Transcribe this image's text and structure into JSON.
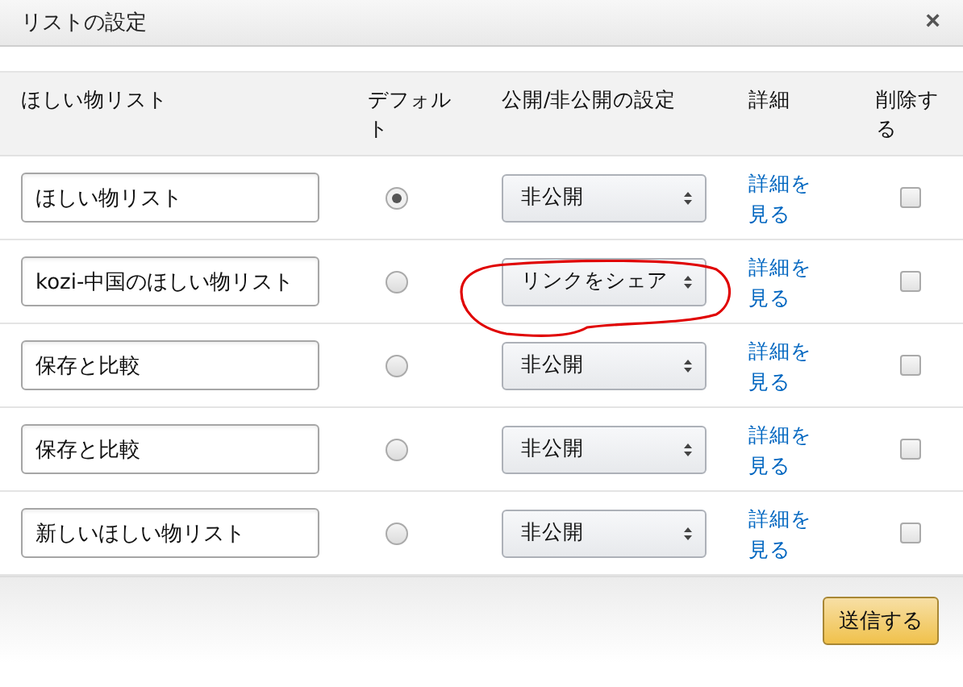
{
  "dialog": {
    "title": "リストの設定",
    "close": "×"
  },
  "columns": [
    "ほしい物リスト",
    "デフォルト",
    "公開/非公開の設定",
    "詳細",
    "削除する"
  ],
  "rows": [
    {
      "name": "ほしい物リスト",
      "selected": true,
      "privacy": "非公開",
      "circled": false,
      "details": "詳細を見る",
      "checked": false
    },
    {
      "name": "kozi-中国のほしい物リスト",
      "selected": false,
      "privacy": "リンクをシェア",
      "circled": true,
      "details": "詳細を見る",
      "checked": false
    },
    {
      "name": "保存と比較",
      "selected": false,
      "privacy": "非公開",
      "circled": false,
      "details": "詳細を見る",
      "checked": false
    },
    {
      "name": "保存と比較",
      "selected": false,
      "privacy": "非公開",
      "circled": false,
      "details": "詳細を見る",
      "checked": false
    },
    {
      "name": "新しいほしい物リスト",
      "selected": false,
      "privacy": "非公開",
      "circled": false,
      "details": "詳細を見る",
      "checked": false
    }
  ],
  "submit": "送信する"
}
